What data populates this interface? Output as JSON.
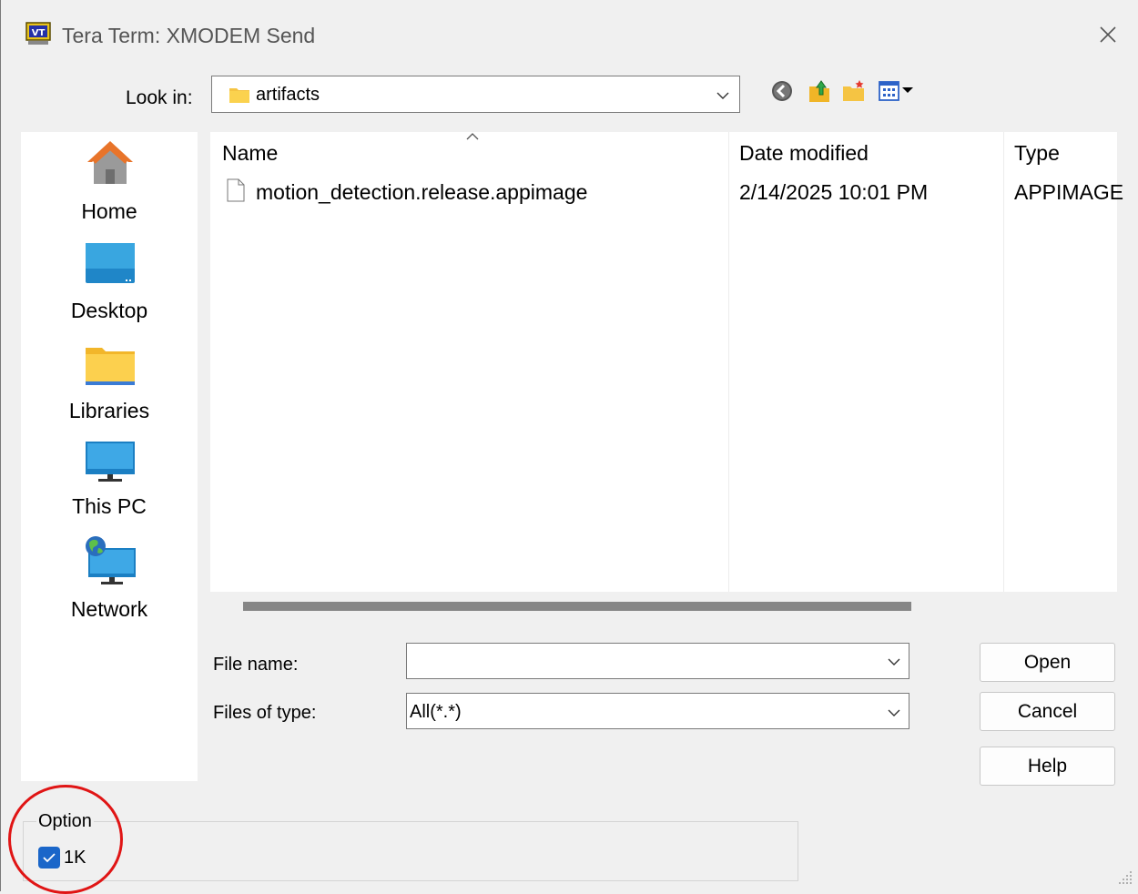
{
  "window": {
    "title": "Tera Term: XMODEM Send",
    "logo_text": "VT"
  },
  "lookin": {
    "label": "Look in:",
    "value": "artifacts"
  },
  "toolbar": {
    "icons": [
      "back-icon",
      "up-folder-icon",
      "new-folder-icon",
      "view-menu-icon"
    ]
  },
  "places": [
    {
      "label": "Home",
      "icon": "home-icon"
    },
    {
      "label": "Desktop",
      "icon": "desktop-icon"
    },
    {
      "label": "Libraries",
      "icon": "libraries-icon"
    },
    {
      "label": "This PC",
      "icon": "this-pc-icon"
    },
    {
      "label": "Network",
      "icon": "network-icon"
    }
  ],
  "filelist": {
    "columns": [
      "Name",
      "Date modified",
      "Type"
    ],
    "rows": [
      {
        "name": "motion_detection.release.appimage",
        "date": "2/14/2025 10:01 PM",
        "type": "APPIMAGE"
      }
    ]
  },
  "form": {
    "file_name_label": "File name:",
    "file_name_value": "",
    "files_of_type_label": "Files of type:",
    "files_of_type_value": "All(*.*)"
  },
  "buttons": {
    "open": "Open",
    "cancel": "Cancel",
    "help": "Help"
  },
  "option": {
    "group_label": "Option",
    "checkbox_label": "1K",
    "checked": true
  },
  "colors": {
    "accent": "#1a66c9",
    "highlight": "#e01515"
  }
}
